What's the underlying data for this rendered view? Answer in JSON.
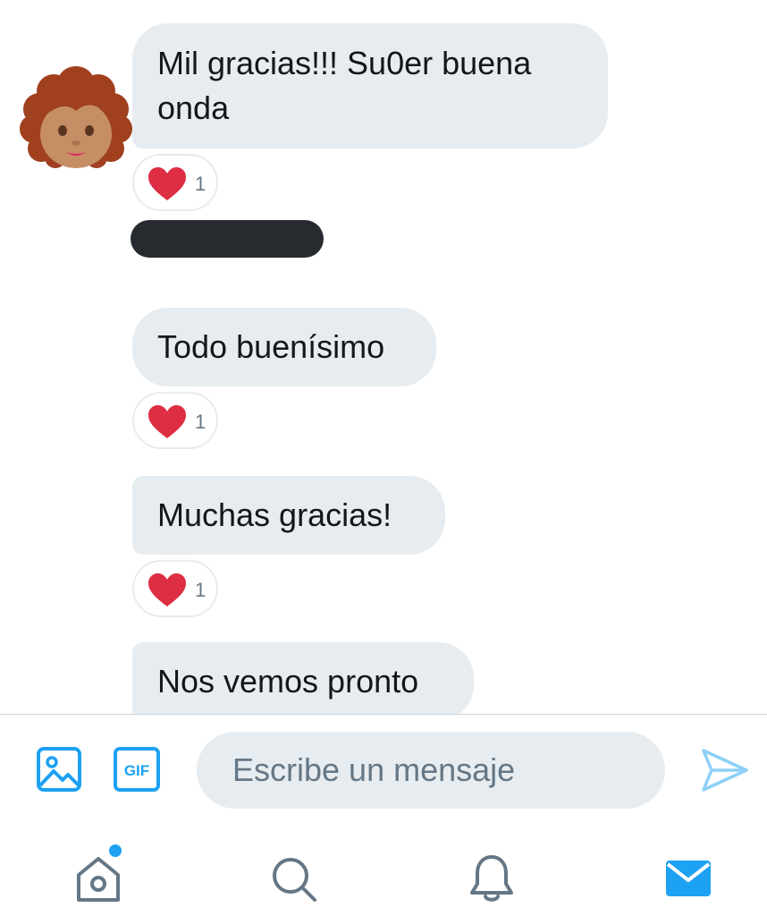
{
  "conversation": {
    "messages": [
      {
        "text": "Mil gracias!!! Su0er buena onda",
        "reaction": {
          "icon": "heart-icon",
          "count": "1"
        }
      },
      {
        "text": "Todo buenísimo",
        "reaction": {
          "icon": "heart-icon",
          "count": "1"
        }
      },
      {
        "text": "Muchas gracias!",
        "reaction": {
          "icon": "heart-icon",
          "count": "1"
        }
      },
      {
        "text": "Nos vemos pronto"
      }
    ]
  },
  "composer": {
    "placeholder": "Escribe un mensaje",
    "value": "",
    "media_icon": "image-icon",
    "gif_label": "GIF",
    "send_icon": "send-icon"
  },
  "tabbar": {
    "items": [
      {
        "icon": "home-icon",
        "has_notification_dot": true
      },
      {
        "icon": "search-icon"
      },
      {
        "icon": "bell-icon"
      },
      {
        "icon": "mail-icon",
        "active": true
      }
    ]
  },
  "colors": {
    "accent": "#1da1f2",
    "bubble": "#e6ecf0",
    "heart": "#e0245e",
    "text": "#14171a",
    "muted": "#657786"
  }
}
